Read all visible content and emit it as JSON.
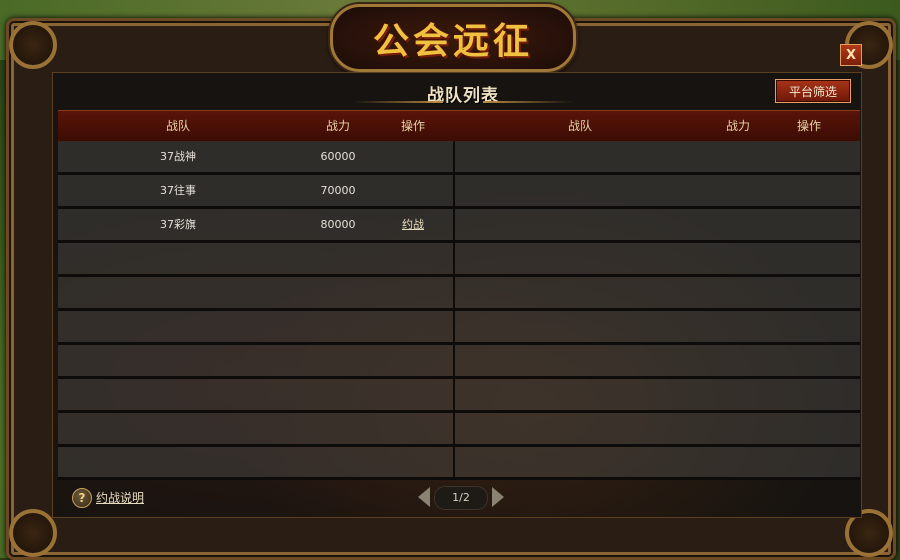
{
  "window": {
    "title": "公会远征",
    "close_label": "X"
  },
  "panel": {
    "subtitle": "战队列表",
    "filter_button": "平台筛选"
  },
  "table": {
    "left_headers": [
      "战队",
      "战力",
      "操作"
    ],
    "right_headers": [
      "战队",
      "战力",
      "操作"
    ],
    "rows": [
      {
        "team": "37战神",
        "power": "60000",
        "action": ""
      },
      {
        "team": "37往事",
        "power": "70000",
        "action": ""
      },
      {
        "team": "37彩旗",
        "power": "80000",
        "action": "约战"
      }
    ]
  },
  "footer": {
    "help_icon": "?",
    "help_link": "约战说明",
    "page": "1/2"
  },
  "colors": {
    "title_gold": "#f0c040",
    "header_red": "#5a1408",
    "button_red": "#a8341a"
  },
  "icons": {
    "close": "close-icon",
    "help": "question-icon",
    "prev": "arrow-left-icon",
    "next": "arrow-right-icon"
  }
}
